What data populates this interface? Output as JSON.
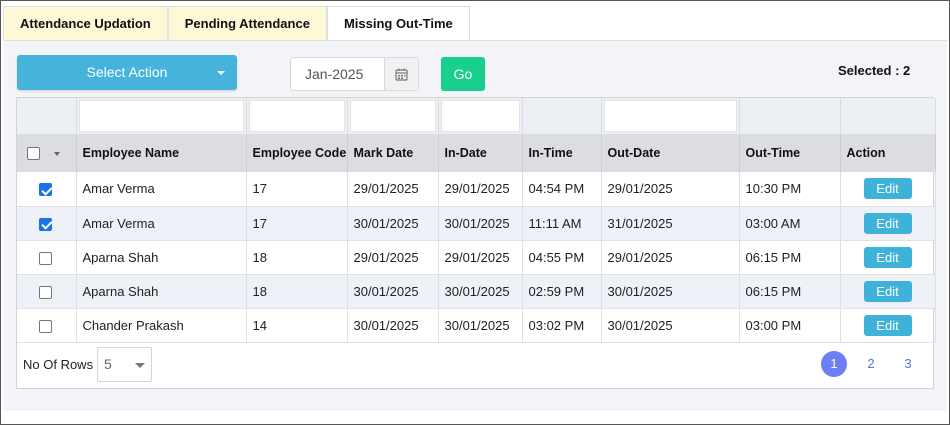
{
  "tabs": [
    {
      "label": "Attendance Updation"
    },
    {
      "label": "Pending Attendance"
    },
    {
      "label": "Missing Out-Time"
    }
  ],
  "toolbar": {
    "select_action_label": "Select Action",
    "date_value": "Jan-2025",
    "go_label": "Go",
    "selected_text": "Selected : 2"
  },
  "table": {
    "columns": [
      "Employee Name",
      "Employee Code",
      "Mark Date",
      "In-Date",
      "In-Time",
      "Out-Date",
      "Out-Time",
      "Action"
    ],
    "rows": [
      {
        "checked": true,
        "name": "Amar Verma",
        "code": "17",
        "mark_date": "29/01/2025",
        "in_date": "29/01/2025",
        "in_time": "04:54 PM",
        "out_date": "29/01/2025",
        "out_time": "10:30 PM",
        "action": "Edit"
      },
      {
        "checked": true,
        "name": "Amar Verma",
        "code": "17",
        "mark_date": "30/01/2025",
        "in_date": "30/01/2025",
        "in_time": "11:11 AM",
        "out_date": "31/01/2025",
        "out_time": "03:00 AM",
        "action": "Edit"
      },
      {
        "checked": false,
        "name": "Aparna Shah",
        "code": "18",
        "mark_date": "29/01/2025",
        "in_date": "29/01/2025",
        "in_time": "04:55 PM",
        "out_date": "29/01/2025",
        "out_time": "06:15 PM",
        "action": "Edit"
      },
      {
        "checked": false,
        "name": "Aparna Shah",
        "code": "18",
        "mark_date": "30/01/2025",
        "in_date": "30/01/2025",
        "in_time": "02:59 PM",
        "out_date": "30/01/2025",
        "out_time": "06:15 PM",
        "action": "Edit"
      },
      {
        "checked": false,
        "name": "Chander Prakash",
        "code": "14",
        "mark_date": "30/01/2025",
        "in_date": "30/01/2025",
        "in_time": "03:02 PM",
        "out_date": "30/01/2025",
        "out_time": "03:00 PM",
        "action": "Edit"
      }
    ]
  },
  "footer": {
    "rows_label": "No Of Rows :",
    "rows_value": "5",
    "pages": [
      "1",
      "2",
      "3"
    ],
    "active_page": "1"
  },
  "colors": {
    "select_action": "#45b3dc",
    "go": "#19cf8d",
    "edit": "#3fb2d9",
    "active_page": "#6c7ff5",
    "checkbox_checked": "#1a73e8"
  }
}
